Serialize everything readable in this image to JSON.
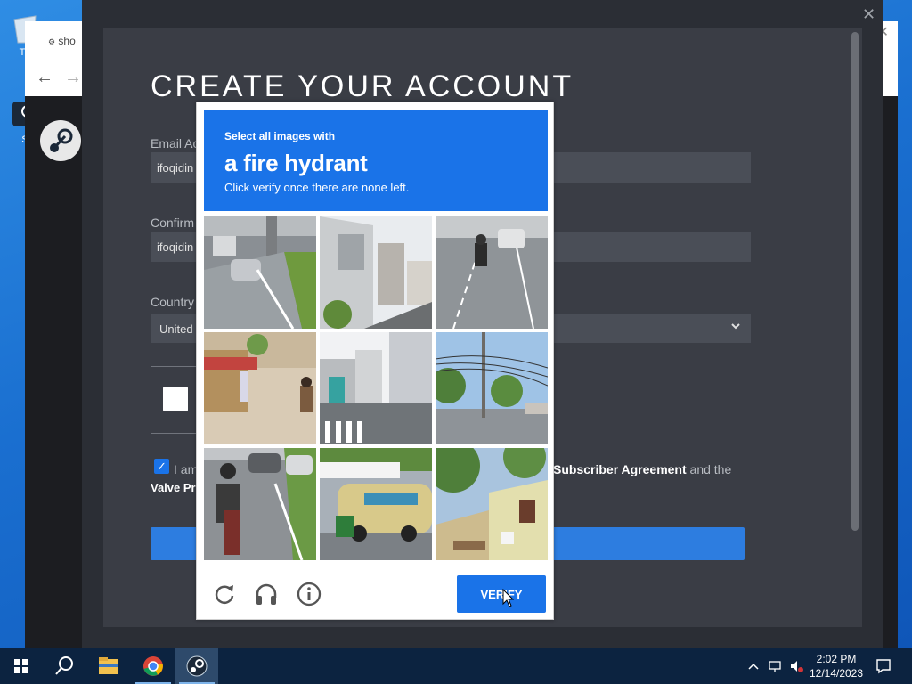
{
  "browser": {
    "tab_label": "sho",
    "back_glyph": "←",
    "forward_glyph": "→",
    "menu_glyph": "⋮",
    "close_glyph": "✕"
  },
  "desktop": {
    "icon1_label": "Th",
    "icon2_label": "S"
  },
  "steam_overlay": {
    "close_glyph": "✕"
  },
  "form": {
    "title": "CREATE YOUR ACCOUNT",
    "email_label": "Email Ac",
    "email_value": "ifoqidin",
    "confirm_label": "Confirm",
    "confirm_value": "ifoqidin",
    "country_label": "Country",
    "country_value": "United",
    "agree_prefix": "I am",
    "agree_middle": "Subscriber Agreement",
    "agree_suffix": " and the",
    "agree_line2": "Valve Pr",
    "check_glyph": "✓"
  },
  "captcha": {
    "line1": "Select all images with",
    "target": "a fire hydrant",
    "line3": "Click verify once there are none left.",
    "verify_label": "VERIFY",
    "tiles": [
      "highway-overpass-cars",
      "narrow-street-houses",
      "motorcycle-on-road",
      "market-street-pedestrians",
      "intersection-crosswalk",
      "street-power-lines-palms",
      "motorcyclist-with-traffic",
      "tanker-truck-motorbike",
      "house-with-trees"
    ]
  },
  "taskbar": {
    "time": "2:02 PM",
    "date": "12/14/2023"
  },
  "colors": {
    "captcha_blue": "#1a73e8",
    "steam_dark": "#2b2e35",
    "steam_panel": "#3a3d45",
    "taskbar": "#0c2340"
  }
}
